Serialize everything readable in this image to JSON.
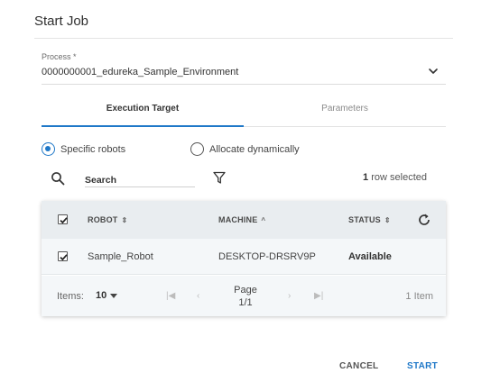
{
  "dialog": {
    "title": "Start Job"
  },
  "process": {
    "label": "Process *",
    "value": "0000000001_edureka_Sample_Environment"
  },
  "tabs": [
    {
      "label": "Execution Target",
      "active": true
    },
    {
      "label": "Parameters",
      "active": false
    }
  ],
  "target_options": [
    {
      "label": "Specific robots",
      "selected": true
    },
    {
      "label": "Allocate dynamically",
      "selected": false
    }
  ],
  "search": {
    "placeholder": "Search"
  },
  "selection": {
    "count": "1",
    "text": "row selected"
  },
  "grid": {
    "columns": [
      {
        "label": "ROBOT",
        "sort": "⇕"
      },
      {
        "label": "MACHINE",
        "sort": "^"
      },
      {
        "label": "STATUS",
        "sort": "⇕"
      }
    ],
    "rows": [
      {
        "checked": true,
        "robot": "Sample_Robot",
        "machine": "DESKTOP-DRSRV9P",
        "status": "Available"
      }
    ],
    "footer": {
      "items_label": "Items:",
      "items_per_page": "10",
      "page_label": "Page",
      "page_value": "1/1",
      "total": "1 Item"
    }
  },
  "actions": {
    "cancel": "CANCEL",
    "start": "START"
  },
  "colors": {
    "accent": "#1f78c8",
    "header_bg": "#e9edf0",
    "row_bg": "#f4f7f9"
  }
}
